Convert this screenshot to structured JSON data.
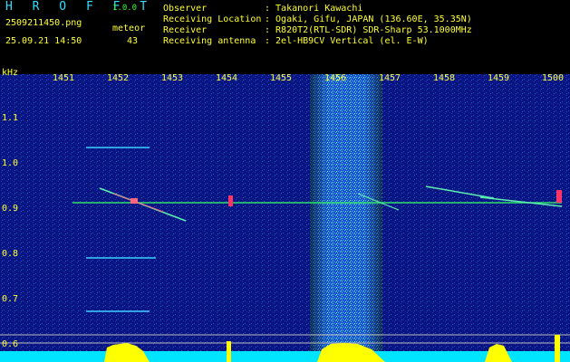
{
  "header": {
    "logo": "H R O F F T",
    "version": "1.0.0",
    "filename": "2509211450.png",
    "datetime": "25.09.21 14:50",
    "meteor_label": "meteor",
    "meteor_count": "43",
    "info_keys": [
      "Observer",
      "Receiving Location",
      "Receiver",
      "Receiving antenna"
    ],
    "info_values": [
      ": Takanori Kawachi",
      ": Ogaki, Gifu, JAPAN (136.60E, 35.35N)",
      ": R820T2(RTL-SDR) SDR-Sharp 53.1000MHz",
      ": 2el-HB9CV Vertical (el. E-W)"
    ]
  },
  "axis": {
    "unit": "kHz",
    "y_ticks": [
      "1.1",
      "1.0",
      "0.9",
      "0.8",
      "0.7",
      "0.6"
    ],
    "x_ticks": [
      "1451",
      "1452",
      "1453",
      "1454",
      "1455",
      "1456",
      "1457",
      "1458",
      "1459",
      "1500"
    ]
  },
  "colors": {
    "header_text": "#ffff33",
    "title_text": "#33ddff",
    "background_noise": "#0a1480",
    "signal_line": "#33ff66",
    "baseline": "#00e5ff",
    "meteor_bars": "#ffff00"
  }
}
